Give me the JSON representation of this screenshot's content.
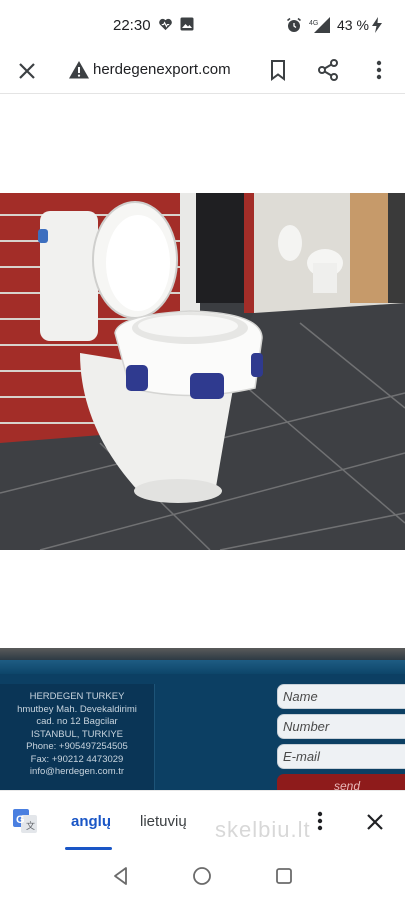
{
  "status": {
    "time": "22:30",
    "network": "4G",
    "battery": "43 %"
  },
  "browser": {
    "url": "herdegenexport.com",
    "icons": {
      "close": "close-icon",
      "warning": "warning-icon",
      "bookmark": "bookmark-icon",
      "share": "share-icon",
      "menu": "more-vert-icon"
    }
  },
  "site": {
    "contact": [
      "HERDEGEN TURKEY",
      "hmutbey Mah. Devekaldirimi",
      "cad. no 12 Bagcilar",
      "ISTANBUL, TURKIYE",
      "Phone: +905497254505",
      "Fax: +90212 4473029",
      "info@herdegen.com.tr"
    ],
    "form": {
      "name_placeholder": "Name",
      "number_placeholder": "Number",
      "email_placeholder": "E-mail",
      "send_label": "send"
    }
  },
  "translate": {
    "source_lang": "anglų",
    "target_lang": "lietuvių",
    "watermark": "skelbiu.lt"
  },
  "colors": {
    "accent": "#1a56c6",
    "site_bg": "#0c3f63",
    "send_button": "#8e1b1b"
  }
}
